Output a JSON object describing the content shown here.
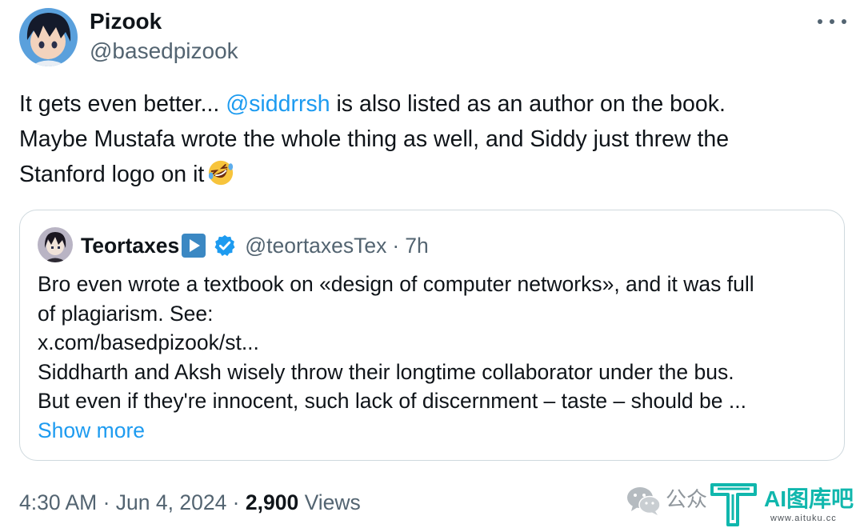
{
  "author": {
    "display_name": "Pizook",
    "handle": "@basedpizook",
    "avatar": "anime-character-avatar"
  },
  "tweet": {
    "line1_pre": "It gets even better... ",
    "mention": "@siddrrsh",
    "line1_post": " is also listed as an author on the book.",
    "line2": "Maybe Mustafa wrote the whole thing as well, and Siddy just threw the",
    "line3": "Stanford logo on it",
    "emoji": "rolling-on-floor-laughing-emoji"
  },
  "quote": {
    "display_name": "Teortaxes",
    "name_badge": "play-button-emoji",
    "verified_icon": "verified-badge-icon",
    "handle": "@teortaxesTex",
    "separator": "·",
    "time": "7h",
    "body_lines": [
      "Bro even wrote a textbook on «design of computer networks», and it was full",
      "of plagiarism. See:",
      "x.com/basedpizook/st...",
      "Siddharth and Aksh wisely throw their longtime collaborator under the bus.",
      "But even if they're innocent, such lack of discernment – taste – should be ..."
    ],
    "show_more": "Show more"
  },
  "meta": {
    "time": "4:30 AM",
    "sep1": " · ",
    "date": "Jun 4, 2024",
    "sep2": " · ",
    "views_count": "2,900",
    "views_label": " Views"
  },
  "watermark": {
    "channel_text": "公众",
    "brand": "AI图库吧",
    "url": "www.aituku.cc"
  },
  "colors": {
    "link": "#1d9bf0",
    "text": "#0f1419",
    "secondary": "#536471",
    "border": "#cfd9de",
    "brand_teal": "#10b7ad"
  }
}
